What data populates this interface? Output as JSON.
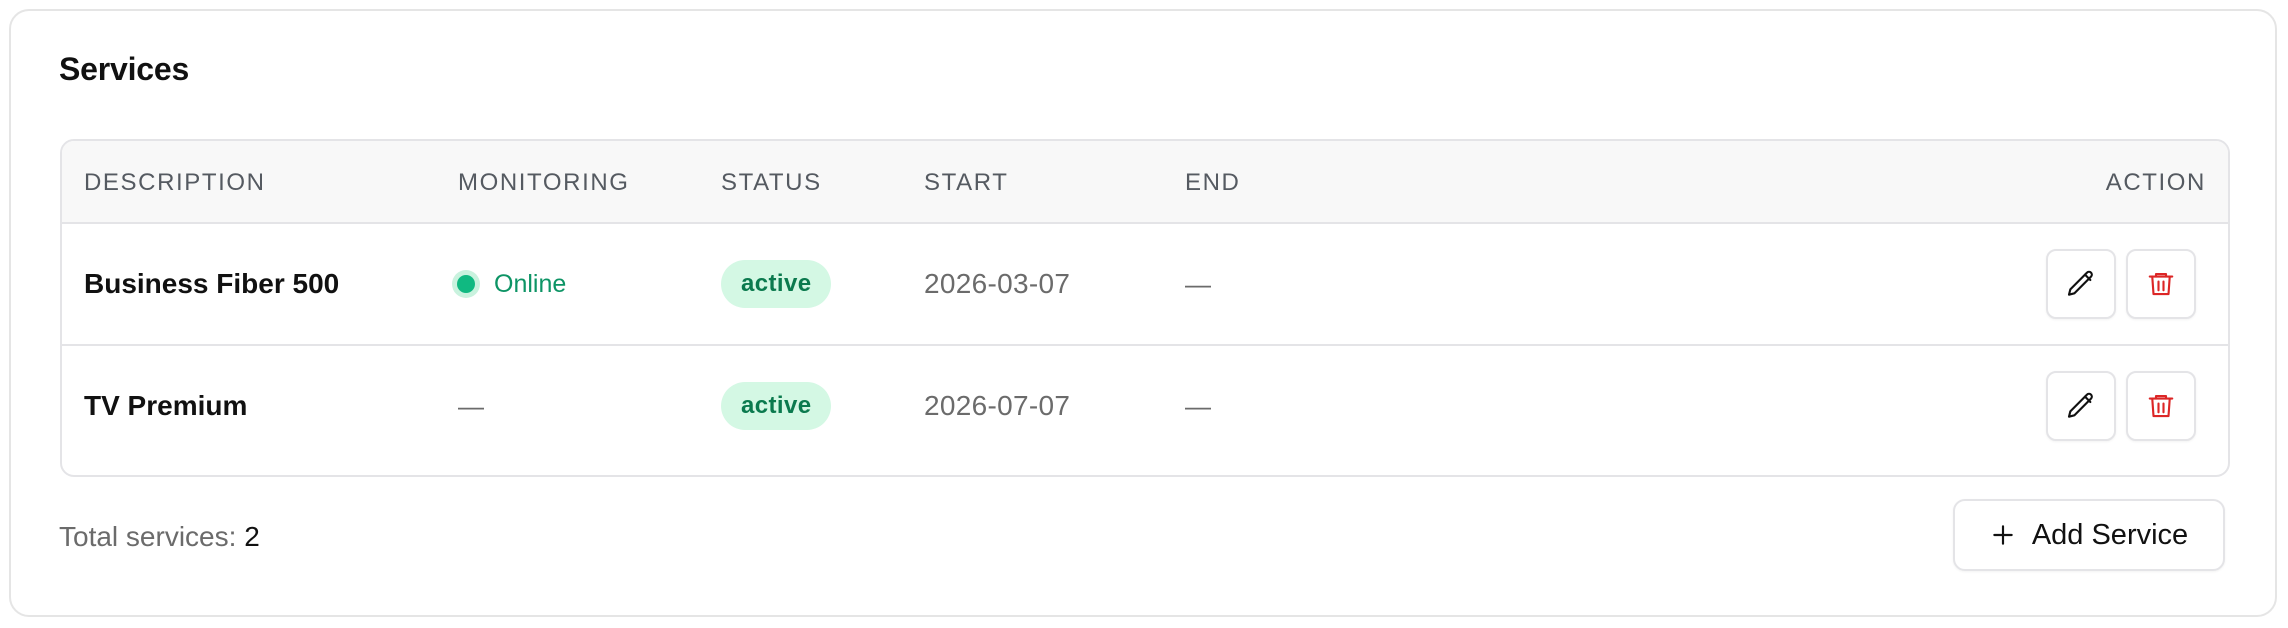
{
  "card": {
    "title": "Services"
  },
  "table": {
    "headers": {
      "description": "DESCRIPTION",
      "monitoring": "MONITORING",
      "status": "STATUS",
      "start": "START",
      "end": "END",
      "action": "ACTION"
    },
    "rows": [
      {
        "description": "Business Fiber 500",
        "monitoring": "Online",
        "monitoring_state": "online",
        "status": "active",
        "start": "2026-03-07",
        "end": "—",
        "actions": {
          "edit_icon": "pencil-icon",
          "delete_icon": "trash-icon"
        }
      },
      {
        "description": "TV Premium",
        "monitoring": "—",
        "monitoring_state": "none",
        "status": "active",
        "start": "2026-07-07",
        "end": "—",
        "actions": {
          "edit_icon": "pencil-icon",
          "delete_icon": "trash-icon"
        }
      }
    ]
  },
  "footer": {
    "total_label": "Total services:",
    "total_count": "2",
    "add_button_label": "Add Service",
    "add_button_icon": "plus-icon"
  },
  "colors": {
    "online": "#10b981",
    "badge_bg": "#d4f8e4",
    "badge_text": "#0b7a4e",
    "delete": "#dc2626"
  }
}
